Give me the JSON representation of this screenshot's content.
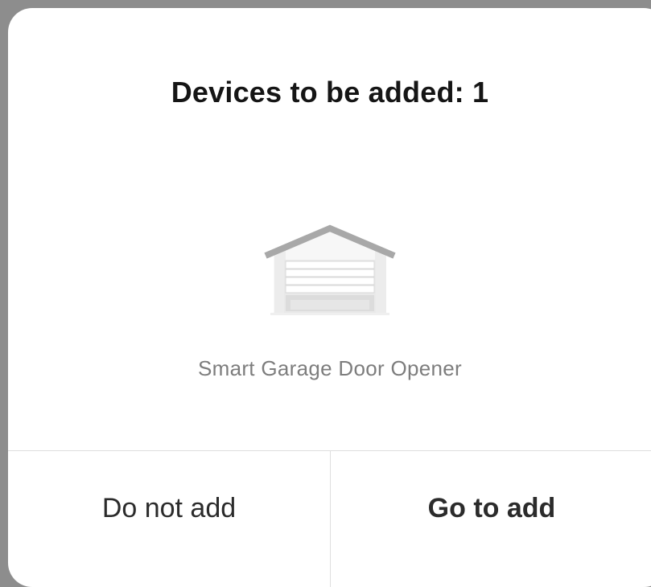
{
  "dialog": {
    "title": "Devices to be added: 1",
    "device": {
      "name": "Smart Garage Door Opener",
      "icon": "garage-icon"
    },
    "buttons": {
      "cancel_label": "Do not add",
      "confirm_label": "Go to add"
    }
  },
  "colors": {
    "backdrop": "#8d8d8d",
    "dialog_bg": "#ffffff",
    "title_text": "#151515",
    "label_text": "#7d7d7d",
    "button_text": "#2b2b2b",
    "divider": "#dedede"
  }
}
